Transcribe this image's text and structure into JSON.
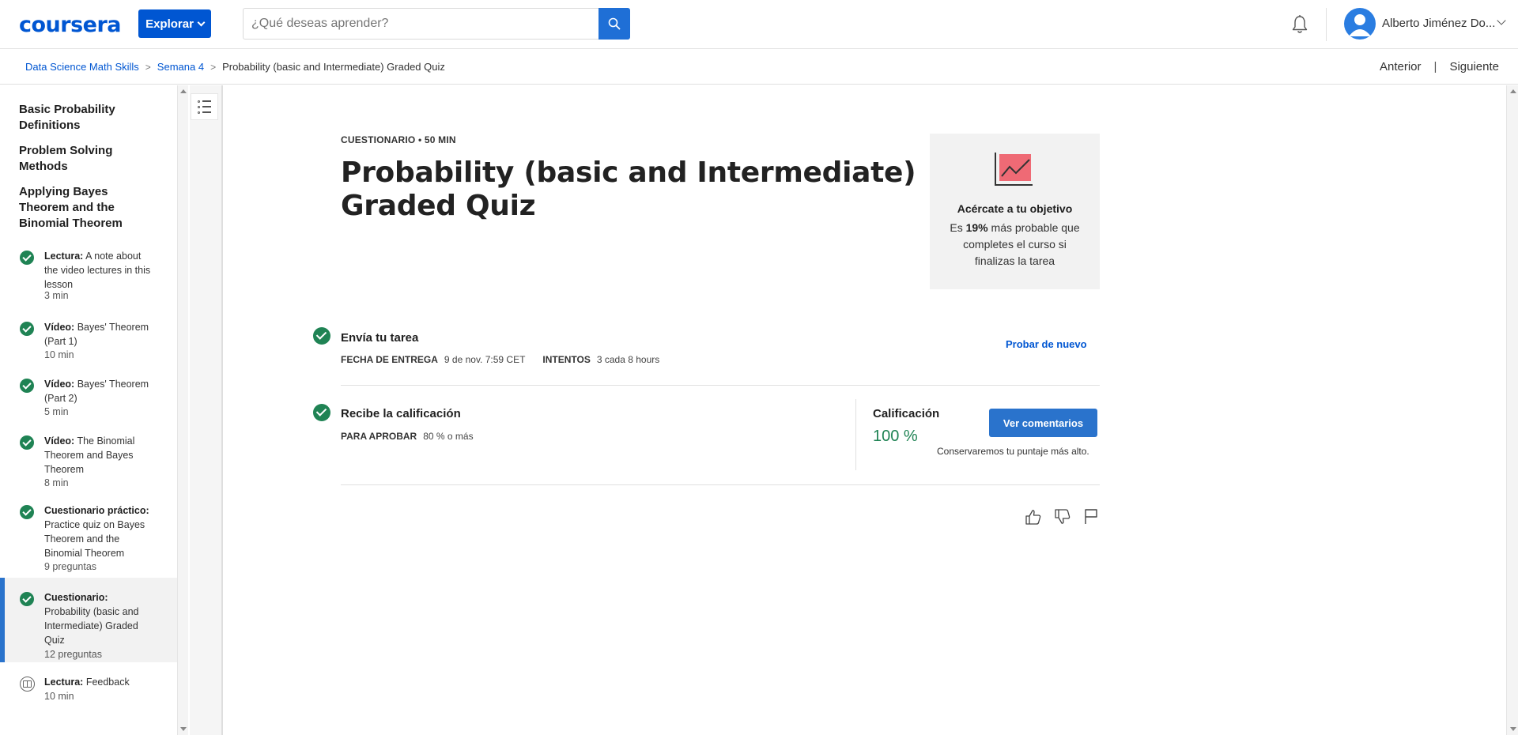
{
  "header": {
    "logo": "coursera",
    "explore_label": "Explorar",
    "search_placeholder": "¿Qué deseas aprender?",
    "user_name": "Alberto Jiménez Do...",
    "icons": [
      "search-icon",
      "bell-icon",
      "avatar-icon",
      "chevron-down-icon"
    ]
  },
  "breadcrumb": {
    "items": [
      "Data Science Math Skills",
      "Semana 4"
    ],
    "current": "Probability (basic and Intermediate) Graded Quiz",
    "separator": ">"
  },
  "nav": {
    "prev": "Anterior",
    "divider": "|",
    "next": "Siguiente"
  },
  "sidebar": {
    "sections": [
      "Basic Probability Definitions",
      "Problem Solving Methods",
      "Applying Bayes Theorem and the Binomial Theorem"
    ],
    "items": [
      {
        "type": "Lectura:",
        "title": "A note about the video lectures in this lesson",
        "meta": "3 min",
        "status": "done"
      },
      {
        "type": "Vídeo:",
        "title": "Bayes' Theorem (Part 1)",
        "meta": "10 min",
        "status": "done"
      },
      {
        "type": "Vídeo:",
        "title": "Bayes' Theorem (Part 2)",
        "meta": "5 min",
        "status": "done"
      },
      {
        "type": "Vídeo:",
        "title": "The Binomial Theorem and Bayes Theorem",
        "meta": "8 min",
        "status": "done"
      },
      {
        "type": "Cuestionario práctico:",
        "title": "Practice quiz on Bayes Theorem and the Binomial Theorem",
        "meta": "9 preguntas",
        "status": "done"
      },
      {
        "type": "Cuestionario:",
        "title": "Probability (basic and Intermediate) Graded Quiz",
        "meta": "12 preguntas",
        "status": "done",
        "active": true
      },
      {
        "type": "Lectura:",
        "title": "Feedback",
        "meta": "10 min",
        "status": "reading"
      }
    ]
  },
  "main": {
    "eyebrow": "CUESTIONARIO • 50 MIN",
    "title": "Probability (basic and Intermediate) Graded Quiz",
    "goal": {
      "title": "Acércate a tu objetivo",
      "text_pre": "Es ",
      "percent": "19%",
      "text_post": " más probable que completes el curso si finalizas la tarea"
    },
    "step1": {
      "title": "Envía tu tarea",
      "due_label": "FECHA DE ENTREGA",
      "due_value": "9 de nov. 7:59 CET",
      "attempts_label": "INTENTOS",
      "attempts_value": "3 cada 8 hours",
      "retry": "Probar de nuevo"
    },
    "step2": {
      "title": "Recibe la calificación",
      "pass_label": "PARA APROBAR",
      "pass_value": "80 % o más",
      "grade_label": "Calificación",
      "grade_value": "100 %",
      "feedback_button": "Ver comentarios",
      "keep_note": "Conservaremos tu puntaje más alto."
    }
  },
  "colors": {
    "brand": "#0056d2",
    "success": "#1f8354",
    "button": "#2a73cc"
  }
}
